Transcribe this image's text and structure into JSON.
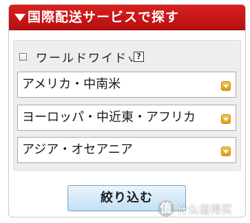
{
  "header": {
    "title": "国際配送サービスで探す"
  },
  "worldwide": {
    "label": "ワールドワイド",
    "checked": false,
    "help_glyph": "?"
  },
  "regions": [
    {
      "value": "アメリカ・中南米"
    },
    {
      "value": "ヨーロッパ・中近東・アフリカ"
    },
    {
      "value": "アジア・オセアニア"
    }
  ],
  "submit": {
    "label": "絞り込む"
  },
  "watermark": {
    "logo_glyph": "值",
    "text": "什么值得买"
  },
  "colors": {
    "header_red": "#c8161a",
    "dropdown_arrow": "#f0b22a",
    "button_blue": "#cfe7f8"
  }
}
